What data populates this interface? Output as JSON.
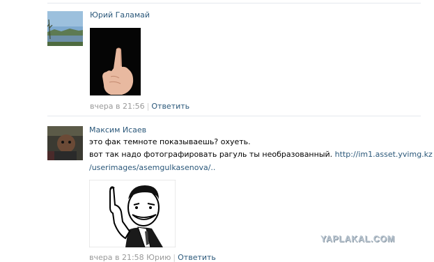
{
  "comments": [
    {
      "author": "Юрий Галамай",
      "avatar_icon": "landscape-avatar",
      "photo_icon": "middle-finger-photo",
      "time": "вчера в 21:56",
      "separator": "|",
      "reply_label": "Ответить"
    },
    {
      "author": "Максим Исаев",
      "avatar_icon": "dark-avatar",
      "text_line1": "это фак темноте показываешь? охуеть.",
      "text_line2_prefix": "вот так надо фотографировать рагуль ты необразованный.",
      "link_part1": "http://im1.asset.yvimg.kz",
      "link_part2": "/userimages/asemgulkasenova/..",
      "photo_icon": "cartoon-man-middle-finger-photo",
      "time": "вчера в 21:58 Юрию",
      "separator": "|",
      "reply_label": "Ответить"
    }
  ],
  "watermark": "YAPLAKAL.COM",
  "colors": {
    "link": "#2b587a",
    "meta": "#999999",
    "divider": "#e4e8ed"
  }
}
